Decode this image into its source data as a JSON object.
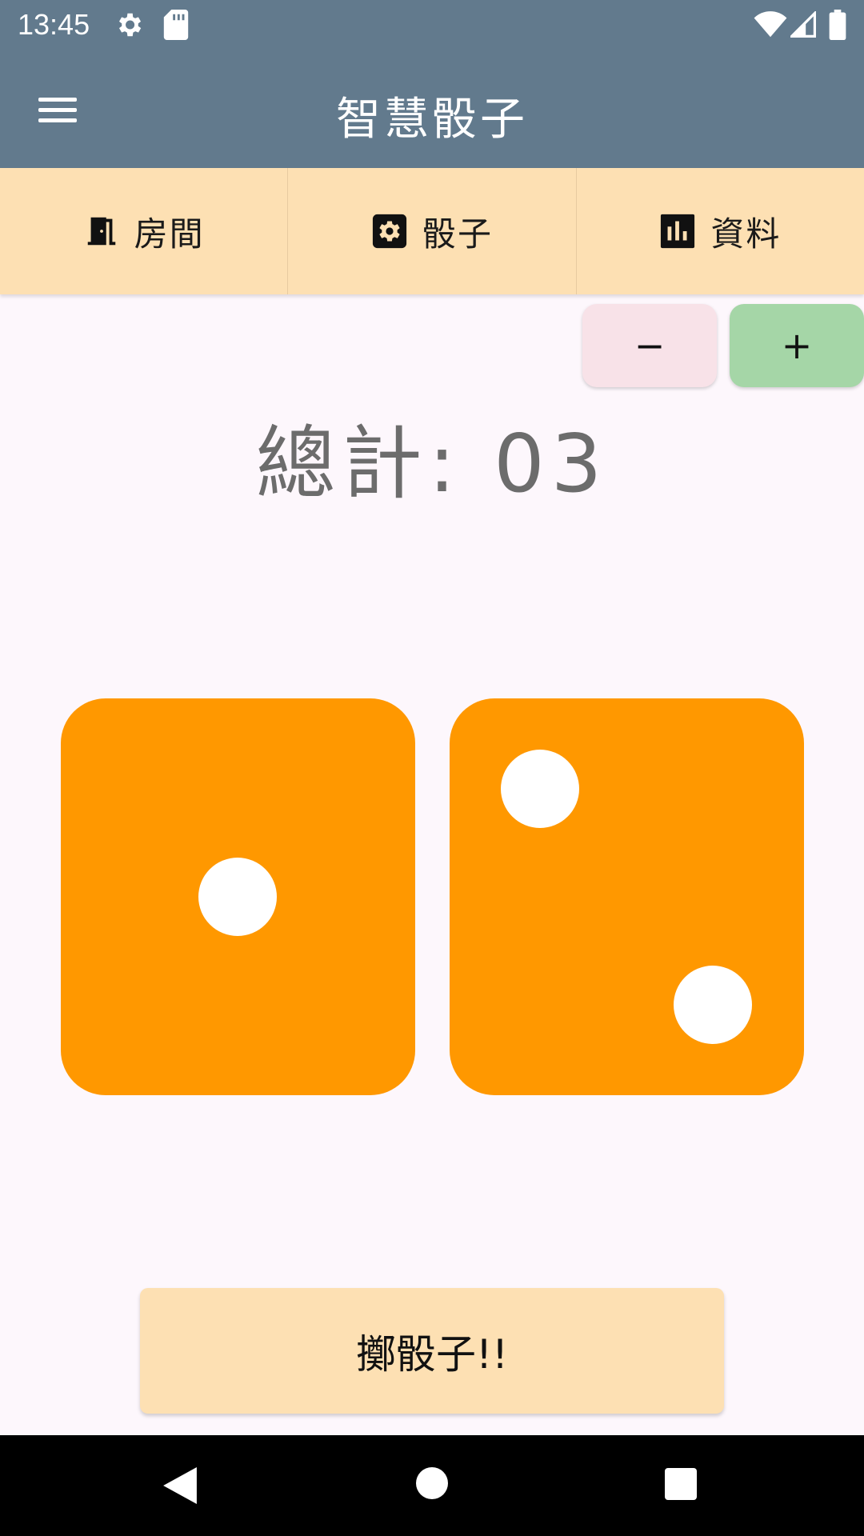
{
  "status_bar": {
    "time": "13:45",
    "left_icons": [
      "settings-icon",
      "sd-card-icon"
    ],
    "right_icons": [
      "wifi-icon",
      "cell-signal-icon",
      "battery-icon"
    ]
  },
  "app_bar": {
    "title": "智慧骰子",
    "menu_icon": "hamburger-menu-icon"
  },
  "tabs": [
    {
      "label": "房間",
      "icon": "door-icon"
    },
    {
      "label": "骰子",
      "icon": "dice-settings-icon"
    },
    {
      "label": "資料",
      "icon": "bar-chart-icon"
    }
  ],
  "controls": {
    "decrement_label": "−",
    "increment_label": "+"
  },
  "total": {
    "label": "總計:",
    "value": "03"
  },
  "dice": [
    {
      "value": 1
    },
    {
      "value": 2
    }
  ],
  "roll_button": {
    "label": "擲骰子!!"
  },
  "colors": {
    "app_bar": "#627a8d",
    "tab_bar": "#fde0b3",
    "die": "#ff9800",
    "pip": "#ffffff",
    "minus_button": "#f8e2e8",
    "plus_button": "#a5d6a7",
    "background": "#fdf7fc"
  },
  "nav_bar": {
    "buttons": [
      "back-icon",
      "home-icon",
      "recents-icon"
    ]
  }
}
